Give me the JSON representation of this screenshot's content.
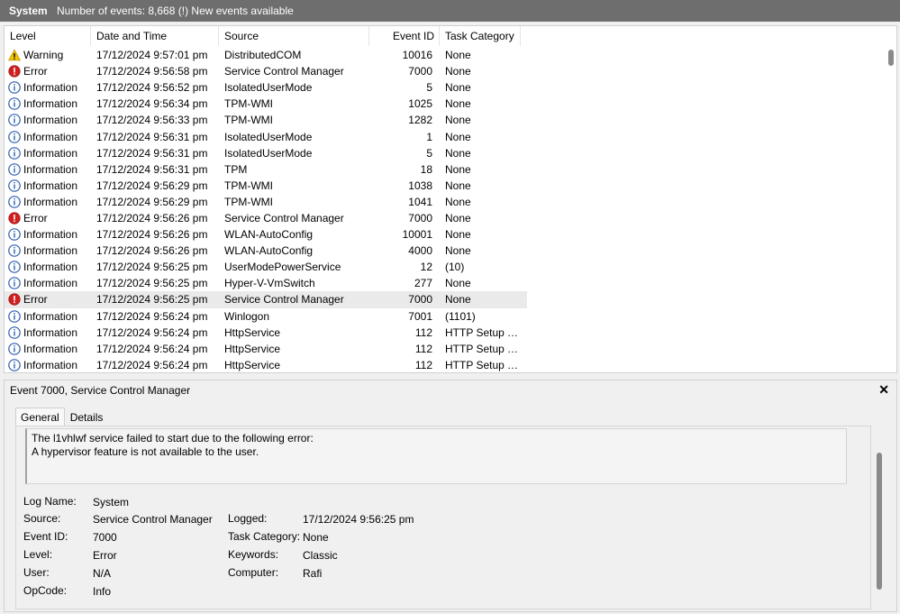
{
  "header": {
    "title": "System",
    "status": "Number of events: 8,668 (!) New events available"
  },
  "columns": {
    "level": "Level",
    "date": "Date and Time",
    "source": "Source",
    "event_id": "Event ID",
    "category": "Task Category"
  },
  "events": [
    {
      "level": "Warning",
      "type": "warning",
      "date": "17/12/2024 9:57:01 pm",
      "source": "DistributedCOM",
      "id": "10016",
      "category": "None"
    },
    {
      "level": "Error",
      "type": "error",
      "date": "17/12/2024 9:56:58 pm",
      "source": "Service Control Manager",
      "id": "7000",
      "category": "None"
    },
    {
      "level": "Information",
      "type": "info",
      "date": "17/12/2024 9:56:52 pm",
      "source": "IsolatedUserMode",
      "id": "5",
      "category": "None"
    },
    {
      "level": "Information",
      "type": "info",
      "date": "17/12/2024 9:56:34 pm",
      "source": "TPM-WMI",
      "id": "1025",
      "category": "None"
    },
    {
      "level": "Information",
      "type": "info",
      "date": "17/12/2024 9:56:33 pm",
      "source": "TPM-WMI",
      "id": "1282",
      "category": "None"
    },
    {
      "level": "Information",
      "type": "info",
      "date": "17/12/2024 9:56:31 pm",
      "source": "IsolatedUserMode",
      "id": "1",
      "category": "None"
    },
    {
      "level": "Information",
      "type": "info",
      "date": "17/12/2024 9:56:31 pm",
      "source": "IsolatedUserMode",
      "id": "5",
      "category": "None"
    },
    {
      "level": "Information",
      "type": "info",
      "date": "17/12/2024 9:56:31 pm",
      "source": "TPM",
      "id": "18",
      "category": "None"
    },
    {
      "level": "Information",
      "type": "info",
      "date": "17/12/2024 9:56:29 pm",
      "source": "TPM-WMI",
      "id": "1038",
      "category": "None"
    },
    {
      "level": "Information",
      "type": "info",
      "date": "17/12/2024 9:56:29 pm",
      "source": "TPM-WMI",
      "id": "1041",
      "category": "None"
    },
    {
      "level": "Error",
      "type": "error",
      "date": "17/12/2024 9:56:26 pm",
      "source": "Service Control Manager",
      "id": "7000",
      "category": "None"
    },
    {
      "level": "Information",
      "type": "info",
      "date": "17/12/2024 9:56:26 pm",
      "source": "WLAN-AutoConfig",
      "id": "10001",
      "category": "None"
    },
    {
      "level": "Information",
      "type": "info",
      "date": "17/12/2024 9:56:26 pm",
      "source": "WLAN-AutoConfig",
      "id": "4000",
      "category": "None"
    },
    {
      "level": "Information",
      "type": "info",
      "date": "17/12/2024 9:56:25 pm",
      "source": "UserModePowerService",
      "id": "12",
      "category": "(10)"
    },
    {
      "level": "Information",
      "type": "info",
      "date": "17/12/2024 9:56:25 pm",
      "source": "Hyper-V-VmSwitch",
      "id": "277",
      "category": "None"
    },
    {
      "level": "Error",
      "type": "error",
      "date": "17/12/2024 9:56:25 pm",
      "source": "Service Control Manager",
      "id": "7000",
      "category": "None",
      "selected": true
    },
    {
      "level": "Information",
      "type": "info",
      "date": "17/12/2024 9:56:24 pm",
      "source": "Winlogon",
      "id": "7001",
      "category": "(1101)"
    },
    {
      "level": "Information",
      "type": "info",
      "date": "17/12/2024 9:56:24 pm",
      "source": "HttpService",
      "id": "112",
      "category": "HTTP Setup Tr..."
    },
    {
      "level": "Information",
      "type": "info",
      "date": "17/12/2024 9:56:24 pm",
      "source": "HttpService",
      "id": "112",
      "category": "HTTP Setup Tr..."
    },
    {
      "level": "Information",
      "type": "info",
      "date": "17/12/2024 9:56:24 pm",
      "source": "HttpService",
      "id": "112",
      "category": "HTTP Setup Tr..."
    }
  ],
  "detail": {
    "title": "Event 7000, Service Control Manager",
    "close_glyph": "✕",
    "tabs": [
      "General",
      "Details"
    ],
    "message_line1": "The l1vhlwf service failed to start due to the following error:",
    "message_line2": "A hypervisor feature is not available to the user.",
    "props": {
      "log_name_label": "Log Name:",
      "log_name": "System",
      "source_label": "Source:",
      "source": "Service Control Manager",
      "logged_label": "Logged:",
      "logged": "17/12/2024 9:56:25 pm",
      "event_id_label": "Event ID:",
      "event_id": "7000",
      "task_category_label": "Task Category:",
      "task_category": "None",
      "level_label": "Level:",
      "level": "Error",
      "keywords_label": "Keywords:",
      "keywords": "Classic",
      "user_label": "User:",
      "user": "N/A",
      "computer_label": "Computer:",
      "computer": "Rafi",
      "opcode_label": "OpCode:",
      "opcode": "Info"
    }
  },
  "colors": {
    "header_bg": "#6e6e6e",
    "error": "#d11f1f",
    "warning": "#f3c300",
    "info": "#2a5db0",
    "selected_row": "#eaeaea"
  }
}
